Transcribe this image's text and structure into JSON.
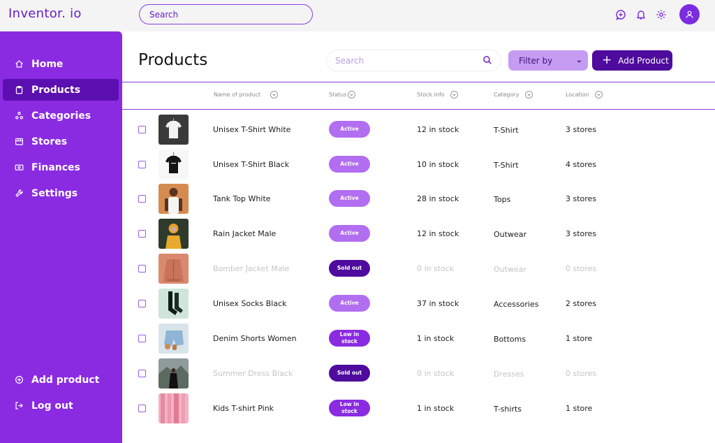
{
  "app": {
    "logo": "Inventor. io"
  },
  "topbar": {
    "search_placeholder": "Search"
  },
  "sidebar": {
    "items": [
      {
        "label": "Home",
        "icon": "home-icon"
      },
      {
        "label": "Products",
        "icon": "clipboard-icon",
        "active": true
      },
      {
        "label": "Categories",
        "icon": "categories-icon"
      },
      {
        "label": "Stores",
        "icon": "store-icon"
      },
      {
        "label": "Finances",
        "icon": "money-icon"
      },
      {
        "label": "Settings",
        "icon": "wrench-icon"
      }
    ],
    "bottom": [
      {
        "label": "Add product",
        "icon": "plus-circle-icon"
      },
      {
        "label": "Log out",
        "icon": "logout-icon"
      }
    ]
  },
  "main": {
    "title": "Products",
    "search_placeholder": "Search",
    "filter_label": "Filter by",
    "add_label": "Add Product"
  },
  "table": {
    "headers": [
      "Name of product",
      "Status",
      "Stock info",
      "Category",
      "Location"
    ],
    "rows": [
      {
        "name": "Unisex T-Shirt White",
        "status": "Active",
        "stock": "12 in stock",
        "category": "T-Shirt",
        "location": "3 stores",
        "muted": false,
        "status_type": "active"
      },
      {
        "name": "Unisex T-Shirt Black",
        "status": "Active",
        "stock": "10 in stock",
        "category": "T-Shirt",
        "location": "4 stores",
        "muted": false,
        "status_type": "active"
      },
      {
        "name": "Tank Top White",
        "status": "Active",
        "stock": "28 in stock",
        "category": "Tops",
        "location": "3 stores",
        "muted": false,
        "status_type": "active"
      },
      {
        "name": "Rain Jacket Male",
        "status": "Active",
        "stock": "12 in stock",
        "category": "Outwear",
        "location": "3 stores",
        "muted": false,
        "status_type": "active"
      },
      {
        "name": "Bomber Jacket Male",
        "status": "Sold out",
        "stock": "0 in stock",
        "category": "Outwear",
        "location": "0 stores",
        "muted": true,
        "status_type": "sold"
      },
      {
        "name": "Unisex Socks Black",
        "status": "Active",
        "stock": "37 in stock",
        "category": "Accessories",
        "location": "2 stores",
        "muted": false,
        "status_type": "active"
      },
      {
        "name": "Denim Shorts Women",
        "status": "Low in stock",
        "stock": "1 in stock",
        "category": "Bottoms",
        "location": "1 store",
        "muted": false,
        "status_type": "low"
      },
      {
        "name": "Summer Dress Black",
        "status": "Sold out",
        "stock": "0 in stock",
        "category": "Dresses",
        "location": "0 stores",
        "muted": true,
        "status_type": "sold"
      },
      {
        "name": "Kids T-shirt Pink",
        "status": "Low in stock",
        "stock": "1 in stock",
        "category": "T-shirts",
        "location": "1 store",
        "muted": false,
        "status_type": "low"
      }
    ]
  },
  "colors": {
    "brand": "#8a2be2",
    "brand_dark": "#4e0b9e",
    "active_badge": "#b16ef0",
    "filter_bg": "#c59cf2"
  }
}
